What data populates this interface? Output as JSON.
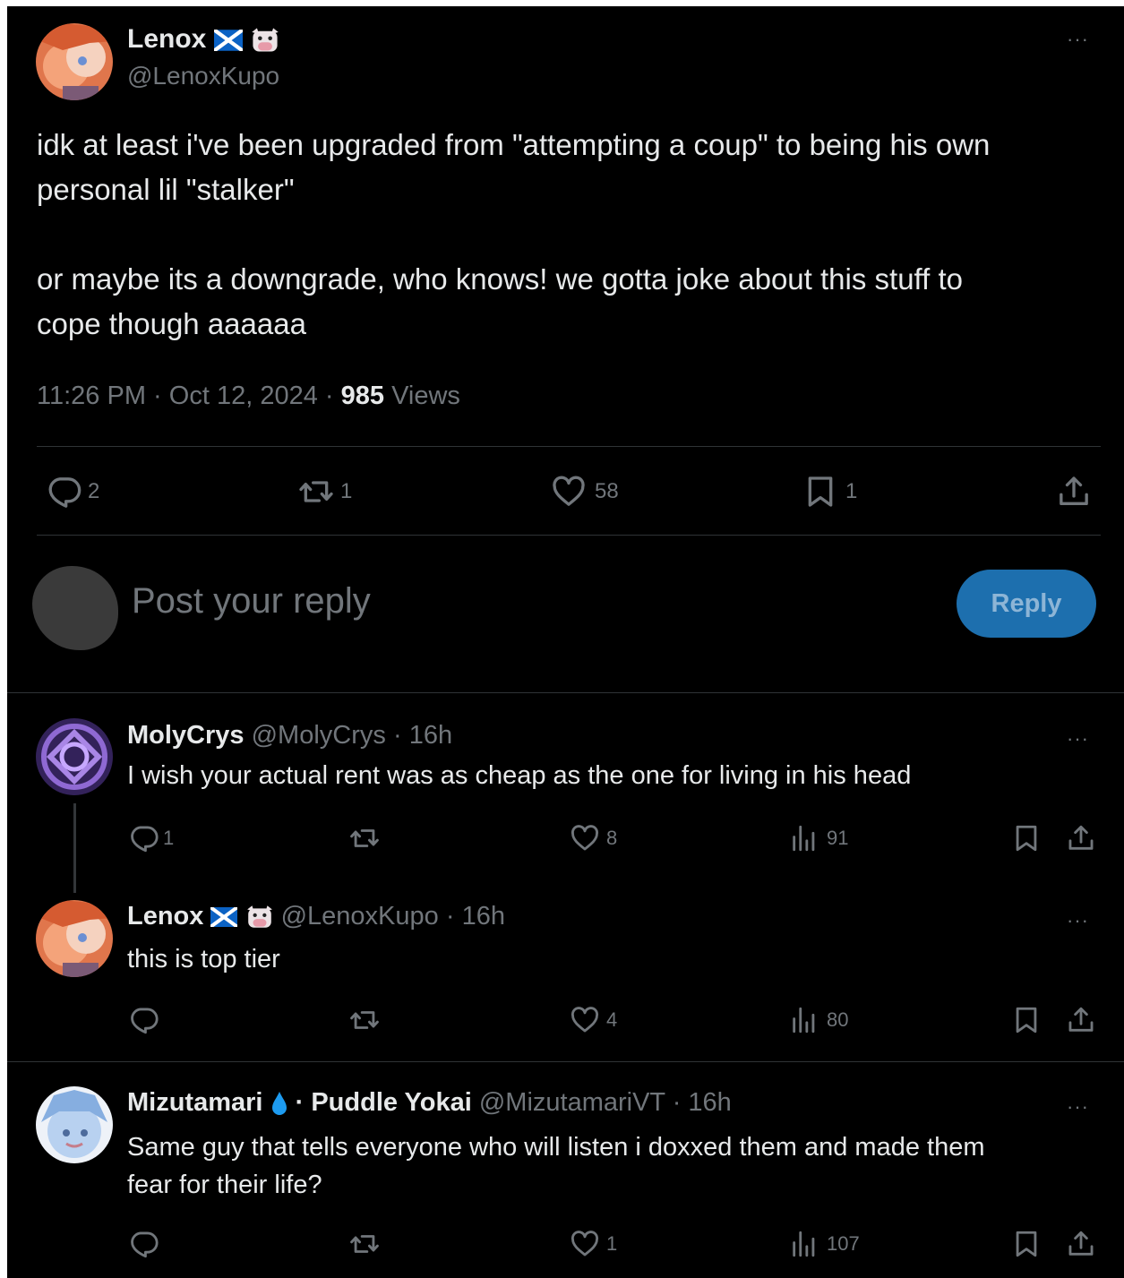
{
  "main_post": {
    "author_name": "Lenox",
    "author_handle": "@LenoxKupo",
    "text_line1": "idk at least i've been upgraded from \"attempting a coup\" to being his own",
    "text_line2": "personal lil \"stalker\"",
    "text_line3": "or maybe its a downgrade, who knows! we gotta joke about this stuff to",
    "text_line4": "cope though aaaaaa",
    "time": "11:26 PM",
    "date": "Oct 12, 2024",
    "views_count": "985",
    "views_label": "Views",
    "replies": "2",
    "reposts": "1",
    "likes": "58",
    "bookmarks": "1"
  },
  "composer": {
    "placeholder": "Post your reply",
    "button_label": "Reply"
  },
  "replies": [
    {
      "author_name": "MolyCrys",
      "author_handle": "@MolyCrys",
      "time": "16h",
      "text": "I wish your actual rent was as cheap as the one for living in his head",
      "replies": "1",
      "reposts": "",
      "likes": "8",
      "views": "91"
    },
    {
      "author_name": "Lenox",
      "author_handle": "@LenoxKupo",
      "time": "16h",
      "text": "this is top tier",
      "replies": "",
      "reposts": "",
      "likes": "4",
      "views": "80"
    },
    {
      "author_name": "Mizutamari",
      "author_suffix": "Puddle Yokai",
      "author_handle": "@MizutamariVT",
      "time": "16h",
      "text_line1": "Same guy that tells everyone who will listen i doxxed them and made them",
      "text_line2": "fear for their life?",
      "replies": "",
      "reposts": "",
      "likes": "1",
      "views": "107"
    }
  ],
  "separator": "·",
  "more_label": "···",
  "icons": [
    "more-icon",
    "reply-icon",
    "repost-icon",
    "like-icon",
    "bookmark-icon",
    "share-icon",
    "views-icon",
    "scotland-flag-icon",
    "cow-icon",
    "water-drop-icon"
  ],
  "colors": {
    "background": "#000000",
    "text": "#e7e9ea",
    "muted": "#71767b",
    "reply_button": "#1d6fae",
    "divider": "#2f3336"
  }
}
